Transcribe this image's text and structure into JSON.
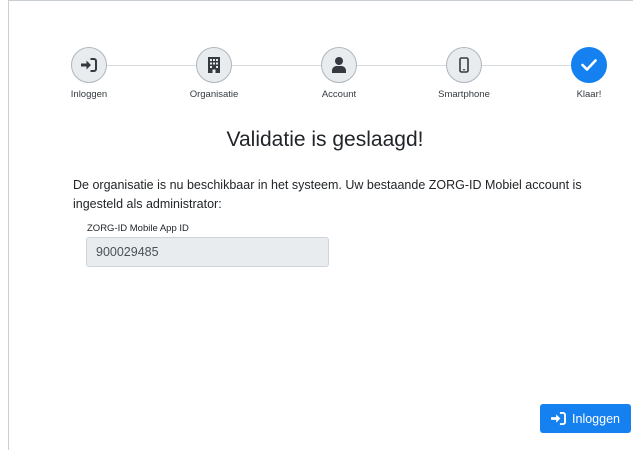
{
  "stepper": {
    "steps": [
      {
        "label": "Inloggen",
        "icon": "sign-in-icon",
        "state": "completed"
      },
      {
        "label": "Organisatie",
        "icon": "building-icon",
        "state": "completed"
      },
      {
        "label": "Account",
        "icon": "user-icon",
        "state": "completed"
      },
      {
        "label": "Smartphone",
        "icon": "mobile-icon",
        "state": "completed"
      },
      {
        "label": "Klaar!",
        "icon": "check-icon",
        "state": "active"
      }
    ]
  },
  "main": {
    "title": "Validatie is geslaagd!",
    "message": "De organisatie is nu beschikbaar in het systeem. Uw bestaande ZORG-ID Mobiel account is ingesteld als administrator:",
    "app_id_field": {
      "label": "ZORG-ID Mobile App ID",
      "value": "900029485"
    }
  },
  "footer": {
    "login_button_label": "Inloggen",
    "login_button_icon": "sign-in-icon"
  },
  "colors": {
    "accent": "#1580f0",
    "step_inactive_bg": "#e9ecef",
    "step_icon": "#343a40",
    "readonly_input_bg": "#e9ecef"
  }
}
